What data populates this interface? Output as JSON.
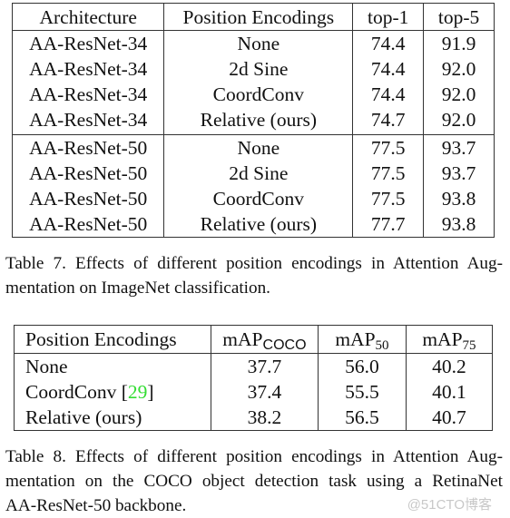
{
  "table7": {
    "headers": [
      "Architecture",
      "Position Encodings",
      "top-1",
      "top-5"
    ],
    "groups": [
      [
        [
          "AA-ResNet-34",
          "None",
          "74.4",
          "91.9"
        ],
        [
          "AA-ResNet-34",
          "2d Sine",
          "74.4",
          "92.0"
        ],
        [
          "AA-ResNet-34",
          "CoordConv",
          "74.4",
          "92.0"
        ],
        [
          "AA-ResNet-34",
          "Relative (ours)",
          "74.7",
          "92.0"
        ]
      ],
      [
        [
          "AA-ResNet-50",
          "None",
          "77.5",
          "93.7"
        ],
        [
          "AA-ResNet-50",
          "2d Sine",
          "77.5",
          "93.7"
        ],
        [
          "AA-ResNet-50",
          "CoordConv",
          "77.5",
          "93.8"
        ],
        [
          "AA-ResNet-50",
          "Relative (ours)",
          "77.7",
          "93.8"
        ]
      ]
    ],
    "caption_lines": [
      "Table 7. Effects of different position encodings in Attention Aug-",
      "mentation on ImageNet classification."
    ]
  },
  "table8": {
    "headers": {
      "col1": "Position Encodings",
      "col2_base": "mAP",
      "col2_sub": "COCO",
      "col3_base": "mAP",
      "col3_sub": "50",
      "col4_base": "mAP",
      "col4_sub": "75"
    },
    "rows": [
      {
        "name": "None",
        "citation": "",
        "values": [
          "37.7",
          "56.0",
          "40.2"
        ]
      },
      {
        "name": "CoordConv ",
        "citation": "29",
        "values": [
          "37.4",
          "55.5",
          "40.1"
        ]
      },
      {
        "name": "Relative (ours)",
        "citation": "",
        "values": [
          "38.2",
          "56.5",
          "40.7"
        ]
      }
    ],
    "citation_color": "#33dd33",
    "caption_lines": [
      "Table 8. Effects of different position encodings in Attention Aug-",
      "mentation on the COCO object detection task using a RetinaNet",
      "AA-ResNet-50 backbone."
    ]
  },
  "watermark": "@51CTO博客"
}
